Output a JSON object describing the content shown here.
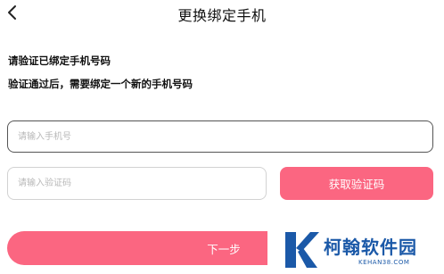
{
  "header": {
    "title": "更换绑定手机",
    "back_icon": "chevron-left-icon"
  },
  "hints": {
    "line1": "请验证已绑定手机号码",
    "line2": "验证通过后，需要绑定一个新的手机号码"
  },
  "form": {
    "phone_placeholder": "请输入手机号",
    "code_placeholder": "请输入验证码",
    "get_code_label": "获取验证码",
    "next_label": "下一步"
  },
  "colors": {
    "accent": "#fb6681",
    "watermark": "#1b59a8"
  },
  "watermark": {
    "name": "柯翰软件园",
    "url": "KEHAN38.COM"
  }
}
